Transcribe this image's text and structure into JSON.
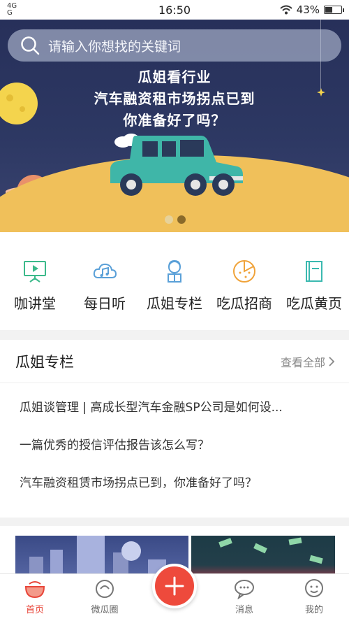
{
  "status_bar": {
    "network_top": "4G",
    "network_bottom": "G",
    "time": "16:50",
    "battery": "43%",
    "battery_level": 0.43
  },
  "search": {
    "placeholder": "请输入你想找的关键词"
  },
  "banner": {
    "lines": [
      "瓜姐看行业",
      "汽车融资租市场拐点已到",
      "你准备好了吗？"
    ],
    "carousel_total": 2,
    "carousel_active": 2
  },
  "quick_nav": [
    {
      "label": "咖讲堂",
      "icon": "presentation-board-icon"
    },
    {
      "label": "每日听",
      "icon": "cloud-music-icon"
    },
    {
      "label": "瓜姐专栏",
      "icon": "girl-reading-icon"
    },
    {
      "label": "吃瓜招商",
      "icon": "melon-slice-icon"
    },
    {
      "label": "吃瓜黄页",
      "icon": "book-icon"
    }
  ],
  "column": {
    "title": "瓜姐专栏",
    "more": "查看全部",
    "items": [
      "瓜姐谈管理 | 高成长型汽车金融SP公司是如何设...",
      "一篇优秀的授信评估报告该怎么写？",
      "汽车融资租赁市场拐点已到，你准备好了吗？"
    ]
  },
  "tabbar": [
    {
      "label": "首页",
      "icon": "home-melon-icon",
      "active": true
    },
    {
      "label": "微瓜圈",
      "icon": "circle-melon-icon",
      "active": false
    },
    {
      "label": "",
      "icon": "plus-icon",
      "active": false
    },
    {
      "label": "消息",
      "icon": "chat-bubble-icon",
      "active": false
    },
    {
      "label": "我的",
      "icon": "user-face-icon",
      "active": false
    }
  ],
  "colors": {
    "accent": "#e8463a",
    "banner_bg": "#2d3863",
    "ground": "#f0c05a",
    "car": "#3fb6a8"
  }
}
